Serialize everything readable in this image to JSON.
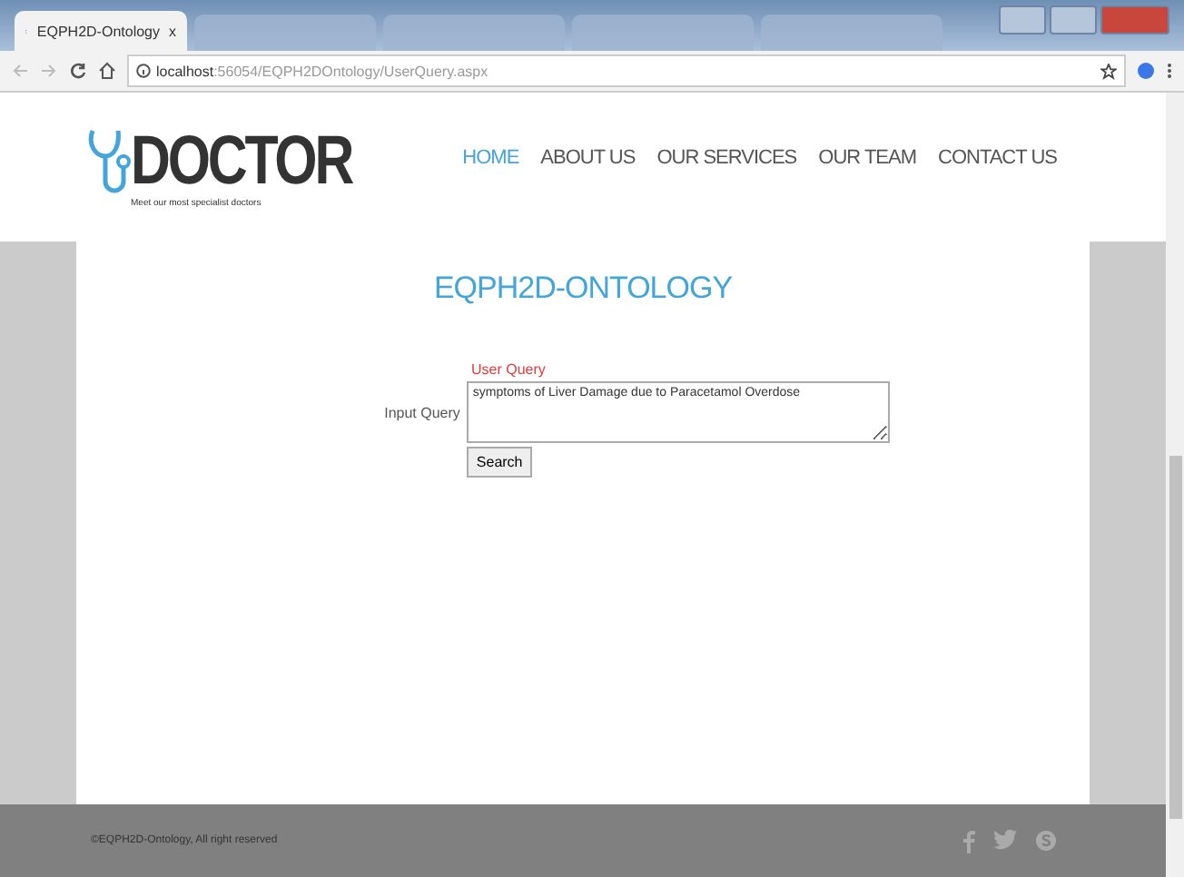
{
  "browser": {
    "tabs": [
      {
        "title": "EQPH2D-Ontology",
        "close": "x",
        "selected": true
      },
      {
        "selected": false
      },
      {
        "selected": false
      },
      {
        "selected": false
      },
      {
        "selected": false
      }
    ],
    "url_host": "localhost",
    "url_path": ":56054/EQPH2DOntology/UserQuery.aspx"
  },
  "logo": {
    "name": "DOCTOR",
    "tagline": "Meet our most specialist doctors"
  },
  "nav": [
    {
      "label": "HOME",
      "selected": true
    },
    {
      "label": "ABOUT US",
      "selected": false
    },
    {
      "label": "OUR SERVICES",
      "selected": false
    },
    {
      "label": "OUR TEAM",
      "selected": false
    },
    {
      "label": "CONTACT US",
      "selected": false
    }
  ],
  "page_title": "EQPH2D-ONTOLOGY",
  "form": {
    "heading": "User Query",
    "label": "Input Query",
    "value": "symptoms of Liver Damage due to Paracetamol Overdose",
    "button": "Search"
  },
  "footer": {
    "copyright": "©EQPH2D-Ontology, All right reserved"
  }
}
